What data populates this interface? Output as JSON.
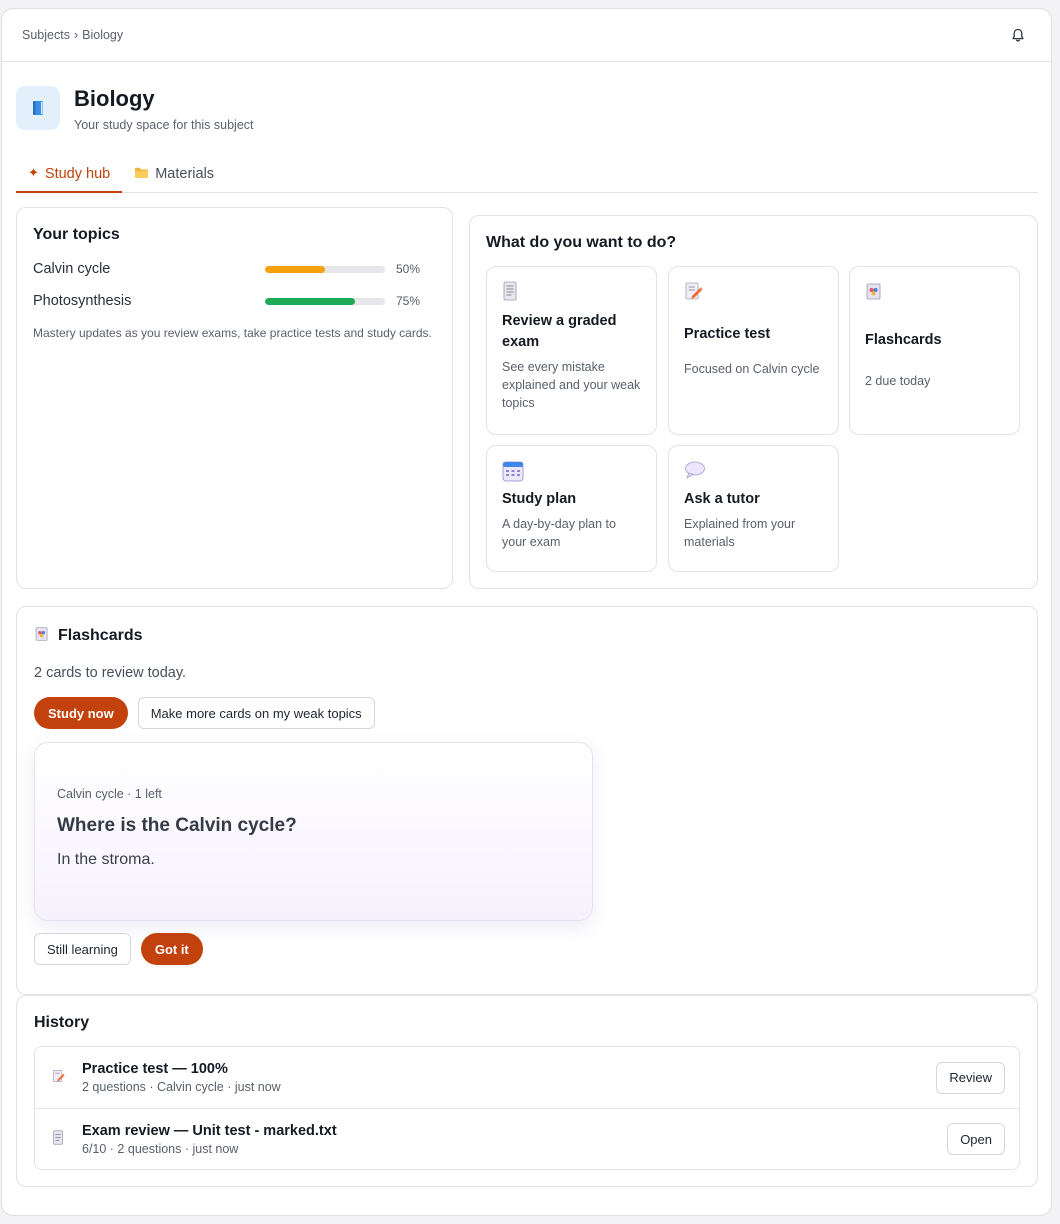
{
  "breadcrumb": {
    "root": "Subjects",
    "separator": "›",
    "current": "Biology"
  },
  "header": {
    "title": "Biology",
    "subtitle": "Your study space for this subject",
    "icon": "book-icon"
  },
  "tabs": [
    {
      "label": "Study hub",
      "icon": "sparkle-icon",
      "active": true
    },
    {
      "label": "Materials",
      "icon": "folder-icon",
      "active": false
    }
  ],
  "topics": {
    "title": "Your topics",
    "items": [
      {
        "name": "Calvin cycle",
        "pct_label": "50%",
        "value": 0.5,
        "color": "#f5a00d"
      },
      {
        "name": "Photosynthesis",
        "pct_label": "75%",
        "value": 0.75,
        "color": "#1faa55"
      }
    ],
    "note": "Mastery updates as you review exams, take practice tests and study cards."
  },
  "actions": {
    "title": "What do you want to do?",
    "items": [
      {
        "title": "Review a graded exam",
        "desc": "See every mistake explained and your weak topics",
        "icon": "document-icon"
      },
      {
        "title": "Practice test",
        "desc": "Focused on Calvin cycle",
        "icon": "memo-pencil-icon"
      },
      {
        "title": "Flashcards",
        "desc": "2 due today",
        "icon": "cards-icon"
      },
      {
        "title": "Study plan",
        "desc": "A day-by-day plan to your exam",
        "icon": "calendar-icon"
      },
      {
        "title": "Ask a tutor",
        "desc": "Explained from your materials",
        "icon": "speech-bubble-icon"
      }
    ]
  },
  "flashcards": {
    "title": "Flashcards",
    "count_text": "2 cards to review today.",
    "study_now": "Study now",
    "make_more": "Make more cards on my weak topics",
    "card": {
      "meta": "Calvin cycle · 1 left",
      "question": "Where is the Calvin cycle?",
      "answer": "In the stroma."
    },
    "still_learning": "Still learning",
    "got_it": "Got it"
  },
  "history": {
    "title": "History",
    "items": [
      {
        "title": "Practice test — 100%",
        "sub": "2 questions · Calvin cycle · just now",
        "action": "Review",
        "icon": "memo-pencil-icon"
      },
      {
        "title": "Exam review — Unit test - marked.txt",
        "sub": "6/10 · 2 questions · just now",
        "action": "Open",
        "icon": "document-icon"
      }
    ]
  },
  "colors": {
    "accent": "#c2410c",
    "amber": "#f5a00d",
    "green": "#1faa55"
  }
}
